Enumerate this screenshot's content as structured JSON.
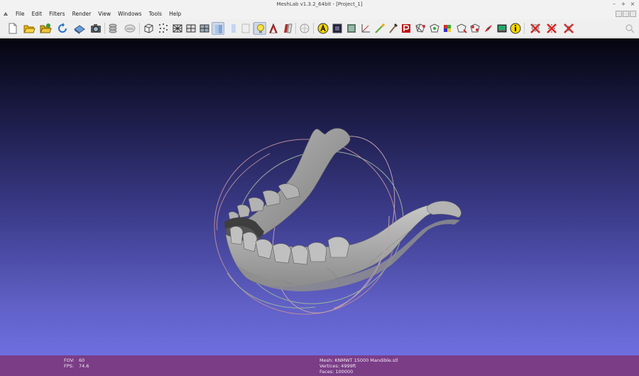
{
  "window": {
    "title": "MeshLab v1.3.2_64bit - [Project_1]",
    "controls": [
      "–",
      "+",
      "×"
    ]
  },
  "menubar": {
    "items": [
      "File",
      "Edit",
      "Filters",
      "Render",
      "View",
      "Windows",
      "Tools",
      "Help"
    ]
  },
  "toolbar": {
    "buttons": [
      "new-project-icon",
      "open-project-icon",
      "import-mesh-icon",
      "reload-icon",
      "save-icon",
      "snapshot-icon",
      "layers-icon",
      "color-icon",
      "bounding-box-icon",
      "points-icon",
      "wireframe-icon",
      "hidden-lines-icon",
      "flat-lines-icon",
      "flat-icon",
      "smooth-icon",
      "texture-icon",
      "lighting-icon",
      "backface-icon",
      "double-side-icon",
      "select-faces-icon",
      "quality-icon",
      "measure-icon",
      "info-icon",
      "delete-faces-icon",
      "delete-vertices-icon",
      "delete-all-icon",
      "search-icon"
    ]
  },
  "status": {
    "fov_label": "FOV:",
    "fov_value": "60",
    "fps_label": "FPS:",
    "fps_value": "74.6",
    "mesh": "Mesh: KNMWT 15000 Mandible.stl",
    "vertices": "Vertices: 4999ft",
    "faces": "Faces: 100000"
  },
  "colors": {
    "status_bg": "#7a3d86",
    "viewport_top": "#05050f",
    "viewport_bottom": "#6e6ee0",
    "mesh": "#a8a8a8"
  }
}
